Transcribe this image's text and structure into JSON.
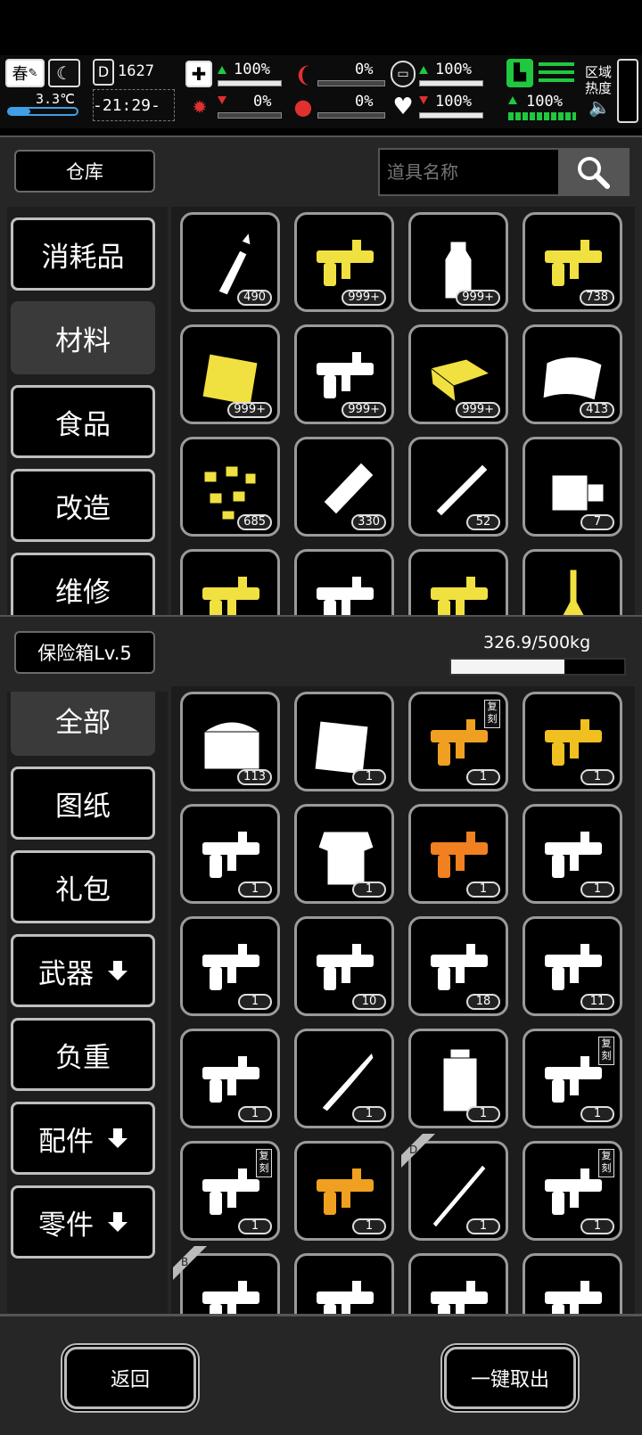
{
  "status": {
    "season": "春",
    "temperature": "3.3℃",
    "day": "1627",
    "clock": "-21:29-",
    "health": "100%",
    "infection": "0%",
    "stomach": "0%",
    "thirst": "0%",
    "armor": "100%",
    "heart": "100%",
    "stamina": "100%",
    "zone_heat_label": "区域\n热度"
  },
  "warehouse": {
    "title": "仓库",
    "search_placeholder": "道具名称",
    "categories": [
      {
        "label": "消耗品",
        "active": false,
        "has_sub": false
      },
      {
        "label": "材料",
        "active": true,
        "has_sub": false
      },
      {
        "label": "食品",
        "active": false,
        "has_sub": false
      },
      {
        "label": "改造",
        "active": false,
        "has_sub": false
      },
      {
        "label": "维修",
        "active": false,
        "has_sub": false
      }
    ],
    "items": [
      {
        "icon": "glue-bottle-icon",
        "qty": "490",
        "color": "#ffffff"
      },
      {
        "icon": "wire-strands-icon",
        "qty": "999+",
        "color": "#f0e040"
      },
      {
        "icon": "plastic-bottle-icon",
        "qty": "999+",
        "color": "#ffffff"
      },
      {
        "icon": "circuit-parts-icon",
        "qty": "738",
        "color": "#f0e040"
      },
      {
        "icon": "metal-plate-icon",
        "qty": "999+",
        "color": "#f0e040"
      },
      {
        "icon": "cloth-scrap-icon",
        "qty": "999+",
        "color": "#ffffff"
      },
      {
        "icon": "fabric-roll-icon",
        "qty": "999+",
        "color": "#f0e040"
      },
      {
        "icon": "leather-sheet-icon",
        "qty": "413",
        "color": "#ffffff"
      },
      {
        "icon": "gold-nuggets-icon",
        "qty": "685",
        "color": "#f0e040"
      },
      {
        "icon": "wood-log-icon",
        "qty": "330",
        "color": "#ffffff"
      },
      {
        "icon": "metal-pipe-icon",
        "qty": "52",
        "color": "#ffffff"
      },
      {
        "icon": "sponge-clip-icon",
        "qty": "7",
        "color": "#ffffff"
      },
      {
        "icon": "copper-wire-icon",
        "qty": "",
        "color": "#f0e040"
      },
      {
        "icon": "radiator-icon",
        "qty": "",
        "color": "#ffffff"
      },
      {
        "icon": "gold-planks-icon",
        "qty": "",
        "color": "#f0e040"
      },
      {
        "icon": "flask-icon",
        "qty": "",
        "color": "#f0e040"
      }
    ]
  },
  "safebox": {
    "title": "保险箱Lv.5",
    "weight": "326.9/500kg",
    "weight_fraction": 0.654,
    "categories": [
      {
        "label": "全部",
        "active": true,
        "has_sub": false
      },
      {
        "label": "图纸",
        "active": false,
        "has_sub": false
      },
      {
        "label": "礼包",
        "active": false,
        "has_sub": false
      },
      {
        "label": "武器",
        "active": false,
        "has_sub": true
      },
      {
        "label": "负重",
        "active": false,
        "has_sub": false
      },
      {
        "label": "配件",
        "active": false,
        "has_sub": true
      },
      {
        "label": "零件",
        "active": false,
        "has_sub": true
      }
    ],
    "items": [
      {
        "icon": "treasure-chest-icon",
        "qty": "113",
        "color": "#ffffff",
        "tag": ""
      },
      {
        "icon": "blueprint-paper-icon",
        "qty": "1",
        "color": "#ffffff",
        "tag": ""
      },
      {
        "icon": "dragon-hammer-icon",
        "qty": "1",
        "color": "#f0a020",
        "tag": "复刻"
      },
      {
        "icon": "golden-mace-icon",
        "qty": "1",
        "color": "#f0c020",
        "tag": ""
      },
      {
        "icon": "gauntlets-icon",
        "qty": "1",
        "color": "#ffffff",
        "tag": ""
      },
      {
        "icon": "chest-armor-icon",
        "qty": "1",
        "color": "#ffffff",
        "tag": ""
      },
      {
        "icon": "orange-launcher-icon",
        "qty": "1",
        "color": "#f08020",
        "tag": ""
      },
      {
        "icon": "ornate-gun-icon",
        "qty": "1",
        "color": "#ffffff",
        "tag": ""
      },
      {
        "icon": "medusa-shield-icon",
        "qty": "1",
        "color": "#ffffff",
        "tag": ""
      },
      {
        "icon": "shotgun-icon",
        "qty": "10",
        "color": "#ffffff",
        "tag": ""
      },
      {
        "icon": "assault-rifle-icon",
        "qty": "18",
        "color": "#ffffff",
        "tag": ""
      },
      {
        "icon": "heavy-pistol-icon",
        "qty": "11",
        "color": "#ffffff",
        "tag": ""
      },
      {
        "icon": "rifle-icon",
        "qty": "1",
        "color": "#ffffff",
        "tag": ""
      },
      {
        "icon": "blade-icon",
        "qty": "1",
        "color": "#ffffff",
        "tag": ""
      },
      {
        "icon": "backpack-icon",
        "qty": "1",
        "color": "#ffffff",
        "tag": ""
      },
      {
        "icon": "minigun-icon",
        "qty": "1",
        "color": "#ffffff",
        "tag": "复刻"
      },
      {
        "icon": "sniper-rifle-icon",
        "qty": "1",
        "color": "#ffffff",
        "tag": "复刻"
      },
      {
        "icon": "golden-shotgun-icon",
        "qty": "1",
        "color": "#f0a020",
        "tag": ""
      },
      {
        "icon": "spear-icon",
        "qty": "1",
        "color": "#ffffff",
        "tag": "",
        "corner": "D"
      },
      {
        "icon": "whip-icon",
        "qty": "1",
        "color": "#ffffff",
        "tag": "复刻"
      },
      {
        "icon": "chain-icon",
        "qty": "",
        "color": "#ffffff",
        "tag": "",
        "corner": "B"
      },
      {
        "icon": "dragon-emblem-icon",
        "qty": "",
        "color": "#ffffff",
        "tag": ""
      },
      {
        "icon": "dragon-emblem-icon",
        "qty": "",
        "color": "#ffffff",
        "tag": ""
      },
      {
        "icon": "dragon-emblem-icon",
        "qty": "",
        "color": "#ffffff",
        "tag": ""
      }
    ]
  },
  "footer": {
    "back_label": "返回",
    "take_all_label": "一键取出"
  }
}
